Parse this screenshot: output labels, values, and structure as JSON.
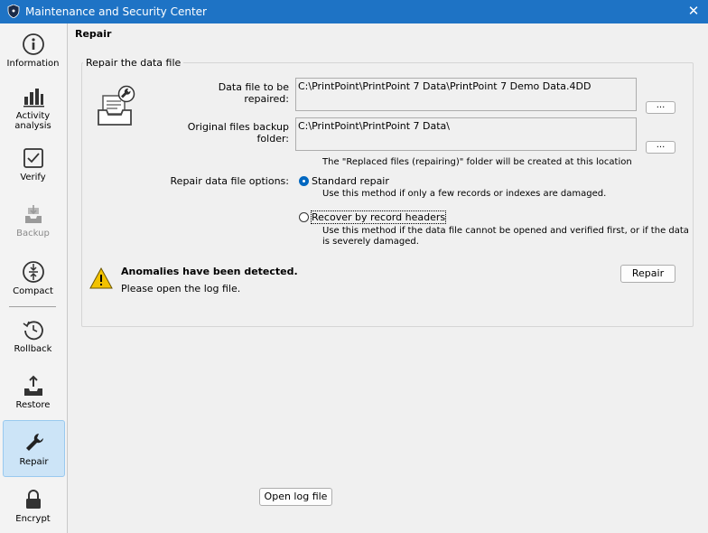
{
  "window": {
    "title": "Maintenance and Security Center",
    "close_glyph": "✕"
  },
  "sidebar": {
    "items": [
      {
        "label": "Information",
        "icon": "info-icon"
      },
      {
        "label": "Activity analysis",
        "icon": "bar-chart-icon"
      },
      {
        "label": "Verify",
        "icon": "checkbox-icon"
      },
      {
        "label": "Backup",
        "icon": "backup-icon",
        "disabled": true
      },
      {
        "label": "Compact",
        "icon": "compact-icon"
      },
      {
        "label": "Rollback",
        "icon": "rollback-icon"
      },
      {
        "label": "Restore",
        "icon": "restore-icon"
      },
      {
        "label": "Repair",
        "icon": "wrench-icon",
        "active": true
      },
      {
        "label": "Encrypt",
        "icon": "lock-icon"
      }
    ]
  },
  "main": {
    "title": "Repair",
    "group_title": "Repair the data file",
    "data_file_label": "Data file to be repaired:",
    "data_file_value": "C:\\PrintPoint\\PrintPoint 7 Data\\PrintPoint 7 Demo Data.4DD",
    "backup_label": "Original files backup folder:",
    "backup_value": "C:\\PrintPoint\\PrintPoint 7 Data\\",
    "browse_label": "...",
    "backup_note": "The \"Replaced files (repairing)\" folder will be created at this location",
    "options_label": "Repair data file options:",
    "option_standard_label": "Standard repair",
    "option_standard_desc": "Use this method if only a few records or indexes are damaged.",
    "option_headers_label": "Recover by record headers",
    "option_headers_desc_1": "Use this method if the data file cannot be opened and verified first, or if the data",
    "option_headers_desc_2": "is severely damaged.",
    "selected_option": "standard",
    "warning_title": "Anomalies have been detected.",
    "warning_text": "Please open the log file.",
    "repair_button": "Repair",
    "open_log_button": "Open log file"
  },
  "colors": {
    "titlebar": "#1e73c5",
    "accent": "#0067c0",
    "active_bg": "#cce4f7",
    "warning": "#f2c200"
  }
}
